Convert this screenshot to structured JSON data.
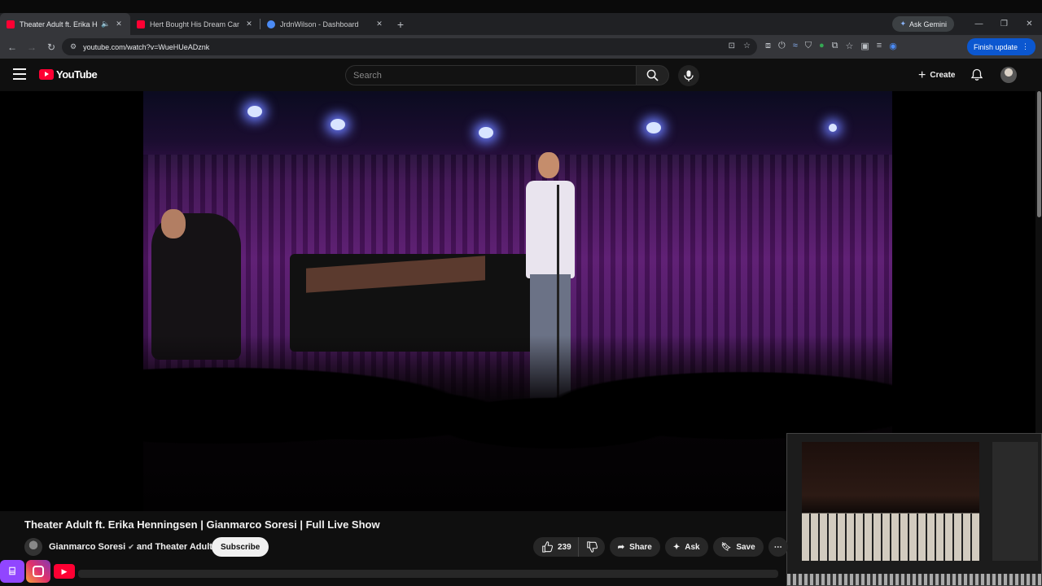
{
  "browser": {
    "tabs": [
      {
        "title": "Theater Adult ft. Erika Henn",
        "favicon_color": "#ff0033",
        "active": true
      },
      {
        "title": "Hert Bought His Dream Car",
        "favicon_color": "#ff0033",
        "active": false
      },
      {
        "title": "JrdnWilson - Dashboard",
        "favicon_color": "#4b8bf5",
        "active": false
      }
    ],
    "ask_gemini": "Ask Gemini",
    "url": "youtube.com/watch?v=WueHUeADznk",
    "finish_update": "Finish update"
  },
  "youtube": {
    "logo_text": "YouTube",
    "search_placeholder": "Search",
    "create_label": "Create"
  },
  "video": {
    "title": "Theater Adult ft. Erika Henningsen | Gianmarco Soresi | Full Live Show",
    "channel": "Gianmarco Soresi",
    "channel_suffix": "and Theater Adult",
    "subscribe": "Subscribe",
    "likes": "239",
    "share": "Share",
    "ask": "Ask",
    "save": "Save"
  },
  "colors": {
    "brand_red": "#ff0033",
    "update_blue": "#0b57d0",
    "stage_purple": "#5a1870"
  }
}
